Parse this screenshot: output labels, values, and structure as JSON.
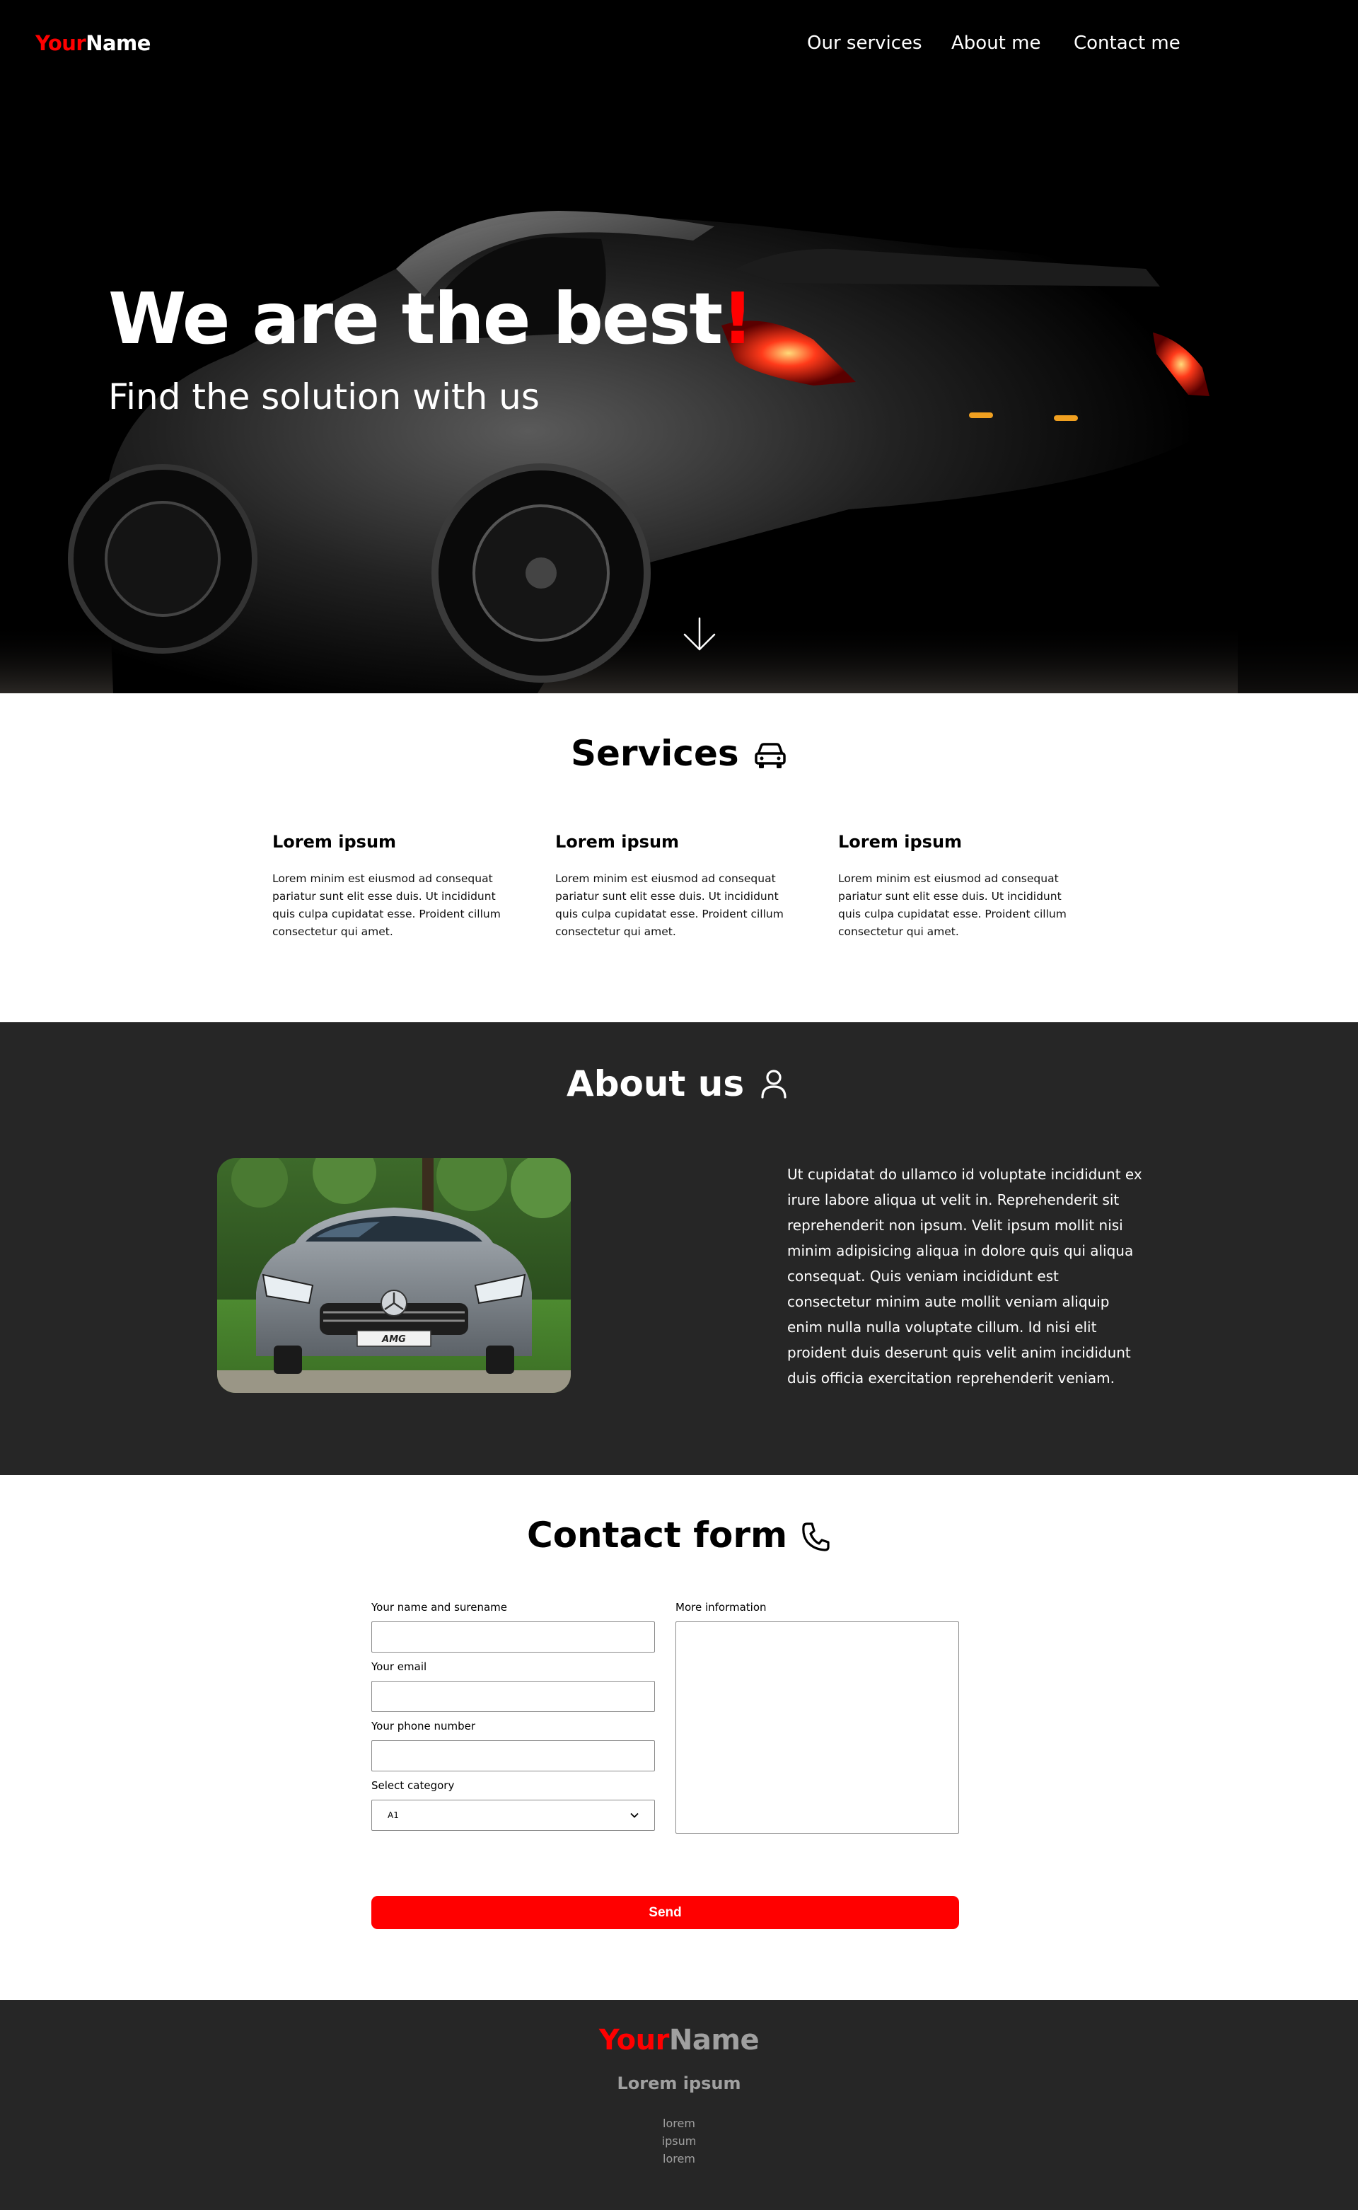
{
  "nav": {
    "logo_part1": "Your",
    "logo_part2": "Name",
    "links": [
      "Our services",
      "About me",
      "Contact me"
    ]
  },
  "hero": {
    "title": "We are the best",
    "title_accent": "!",
    "subtitle": "Find the solution with us"
  },
  "services": {
    "heading": "Services",
    "icon": "car-icon",
    "items": [
      {
        "title": "Lorem ipsum",
        "text": "Lorem minim est eiusmod ad consequat pariatur sunt elit esse duis. Ut incididunt quis culpa cupidatat esse. Proident cillum consectetur qui amet."
      },
      {
        "title": "Lorem ipsum",
        "text": "Lorem minim est eiusmod ad consequat pariatur sunt elit esse duis. Ut incididunt quis culpa cupidatat esse. Proident cillum consectetur qui amet."
      },
      {
        "title": "Lorem ipsum",
        "text": "Lorem minim est eiusmod ad consequat pariatur sunt elit esse duis. Ut incididunt quis culpa cupidatat esse. Proident cillum consectetur qui amet."
      }
    ]
  },
  "about": {
    "heading": "About us",
    "icon": "user-icon",
    "text": "Ut cupidatat do ullamco id voluptate incididunt ex irure labore aliqua ut velit in. Reprehenderit sit reprehenderit non ipsum. Velit ipsum mollit nisi minim adipisicing aliqua in dolore quis qui aliqua consequat. Quis veniam incididunt est consectetur minim aute mollit veniam aliquip enim nulla nulla voluptate cillum. Id nisi elit proident duis deserunt quis velit anim incididunt duis officia exercitation reprehenderit veniam.",
    "badge": "AMG"
  },
  "contact": {
    "heading": "Contact form",
    "icon": "phone-icon",
    "name_label": "Your name and surename",
    "email_label": "Your email",
    "phone_label": "Your phone number",
    "category_label": "Select category",
    "category_value": "A1",
    "info_label": "More information",
    "send_label": "Send"
  },
  "footer": {
    "logo_part1": "Your",
    "logo_part2": "Name",
    "heading": "Lorem ipsum",
    "links": [
      "lorem",
      "ipsum",
      "lorem"
    ]
  },
  "colors": {
    "accent": "#ff0000",
    "dark_section": "#262626",
    "hero_bg": "#000000",
    "footer_text": "#a0a0a0"
  }
}
